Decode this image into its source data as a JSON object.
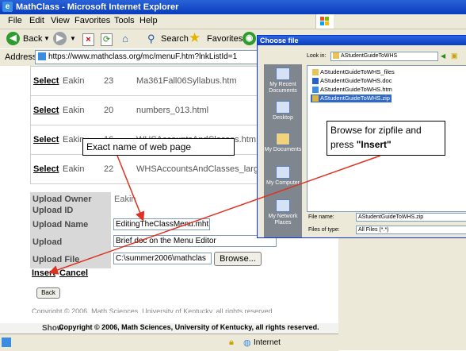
{
  "window": {
    "title": "MathClass - Microsoft Internet Explorer"
  },
  "menu": [
    "File",
    "Edit",
    "View",
    "Favorites",
    "Tools",
    "Help"
  ],
  "toolbar": {
    "back": "Back",
    "search": "Search",
    "favorites": "Favorites"
  },
  "address": {
    "label": "Address",
    "url": "https://www.mathclass.org/mc/menuF.htm?lnkListId=1"
  },
  "rows": [
    {
      "select": "Select",
      "owner": "Eakin",
      "id": "23",
      "name": "Ma361Fall06Syllabus.htm"
    },
    {
      "select": "Select",
      "owner": "Eakin",
      "id": "20",
      "name": "numbers_013.html"
    },
    {
      "select": "Select",
      "owner": "Eakin",
      "id": "16",
      "name": "WHSAccountsAndClasses.htm"
    },
    {
      "select": "Select",
      "owner": "Eakin",
      "id": "22",
      "name": "WHSAccountsAndClasses_larg"
    }
  ],
  "upload": {
    "owner_label": "Upload Owner",
    "owner_value": "Eakin",
    "id_label": "Upload ID",
    "name_label": "Upload Name",
    "name_value": "EditingTheClassMenu.mht",
    "desc_label": "Upload Description",
    "desc_value": "Brief doc on the Menu Editor",
    "file_label": "Upload File",
    "file_value": "C:\\summer2006\\mathclas",
    "browse": "Browse...",
    "insert": "Insert",
    "cancel": "Cancel",
    "back": "Back"
  },
  "footer": {
    "partial_copyright": "Copyright © 2006, Math Sciences, University of Kentucky, all rights reserved.",
    "overlay_copyright": "Copyright © 2006, Math Sciences, University of Kentucky, all rights reserved.",
    "show": "Show"
  },
  "status": {
    "zone": "Internet"
  },
  "dialog": {
    "title": "Choose file",
    "lookin_label": "Look in:",
    "lookin_value": "AStudentGuideToWHS",
    "side": [
      "My Recent Documents",
      "Desktop",
      "My Documents",
      "My Computer",
      "My Network Places"
    ],
    "files": [
      "AStudentGuideToWHS_files",
      "AStudentGuideToWHS.doc",
      "AStudentGuideToWHS.htm",
      "AStudentGuideToWHS.zip"
    ],
    "filename_label": "File name:",
    "filename_value": "AStudentGuideToWHS.zip",
    "filetype_label": "Files of type:",
    "filetype_value": "All Files (*.*)"
  },
  "annotations": {
    "exact_name": "Exact name of web page",
    "browse_note_1": "Browse for zipfile and",
    "browse_note_2": "press ",
    "browse_note_3": "\"Insert\""
  },
  "colors": {
    "accent_arrow": "#e0301e",
    "titlebar": "#0a3bbd"
  }
}
